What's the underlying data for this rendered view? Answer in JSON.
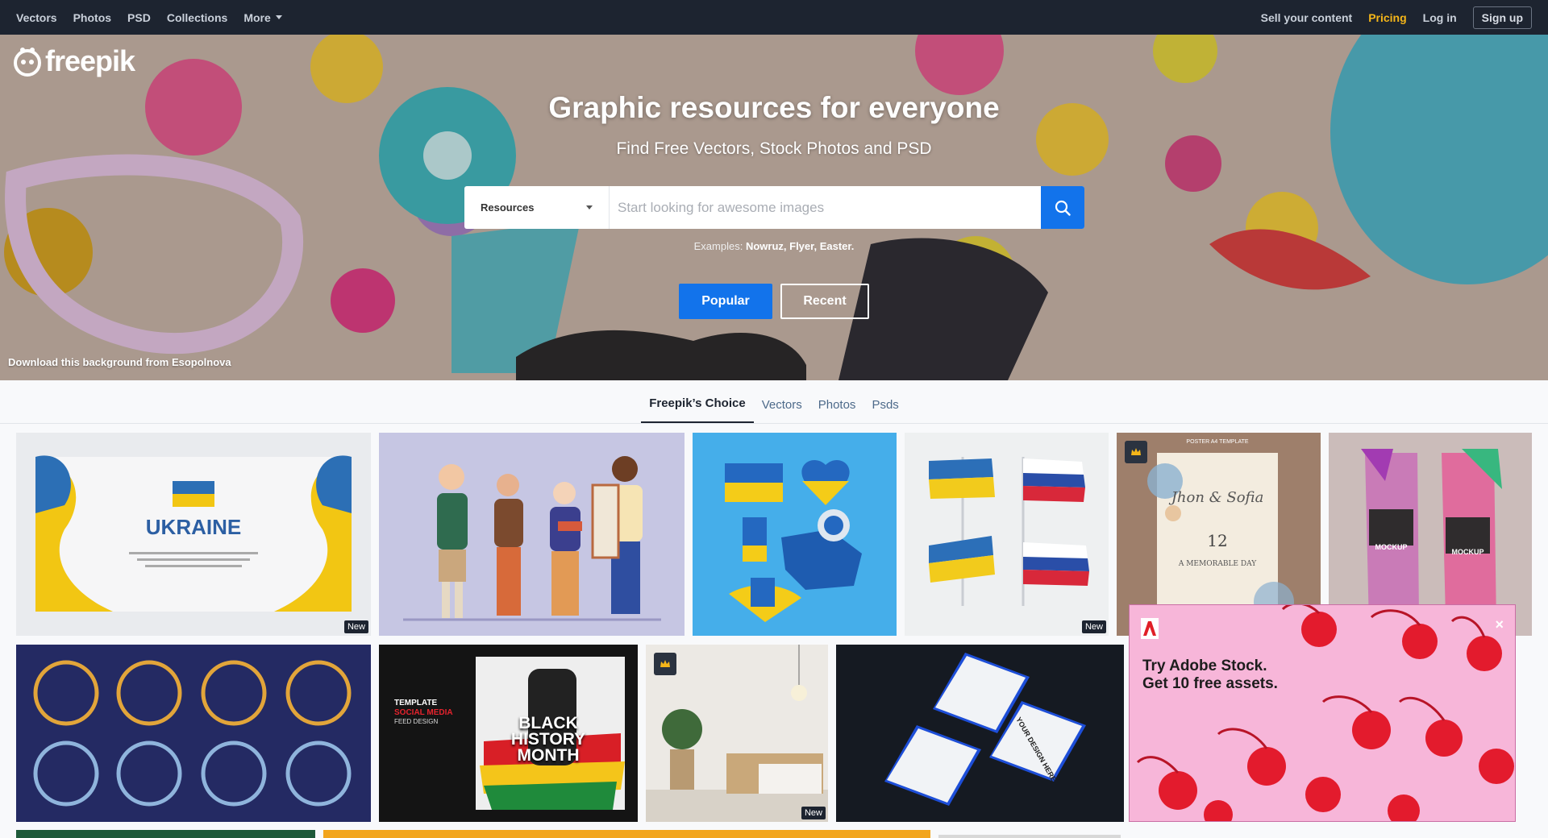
{
  "nav": {
    "left": [
      "Vectors",
      "Photos",
      "PSD",
      "Collections"
    ],
    "more": "More",
    "sell": "Sell your content",
    "pricing": "Pricing",
    "login": "Log in",
    "signup": "Sign up"
  },
  "brand": {
    "name": "freepik"
  },
  "hero": {
    "title": "Graphic resources for everyone",
    "subtitle": "Find Free Vectors, Stock Photos and PSD",
    "search_type": "Resources",
    "search_placeholder": "Start looking for awesome images",
    "examples_label": "Examples:",
    "examples": [
      "Nowruz,",
      "Flyer,",
      "Easter."
    ],
    "btn_popular": "Popular",
    "btn_recent": "Recent",
    "credit": "Download this background from Esopolnova"
  },
  "tabs": [
    "Freepik’s Choice",
    "Vectors",
    "Photos",
    "Psds"
  ],
  "tiles": {
    "ukraine_text": "UKRAINE",
    "new_label": "New",
    "invite_name": "Jhon & Sofia",
    "invite_date": "12",
    "invite_footer": "A MEMORABLE DAY",
    "invite_header": "POSTER A4 TEMPLATE",
    "mockup_label": "MOCKUP",
    "bhm_title": "BLACK HISTORY MONTH",
    "bhm_template": "TEMPLATE",
    "bhm_social": "SOCIAL MEDIA",
    "bhm_feed": "FEED DESIGN",
    "phone_text": "YOUR DESIGN HERE"
  },
  "ad": {
    "title_line1": "Try Adobe Stock.",
    "title_line2": "Get 10 free assets.",
    "close": "×"
  }
}
